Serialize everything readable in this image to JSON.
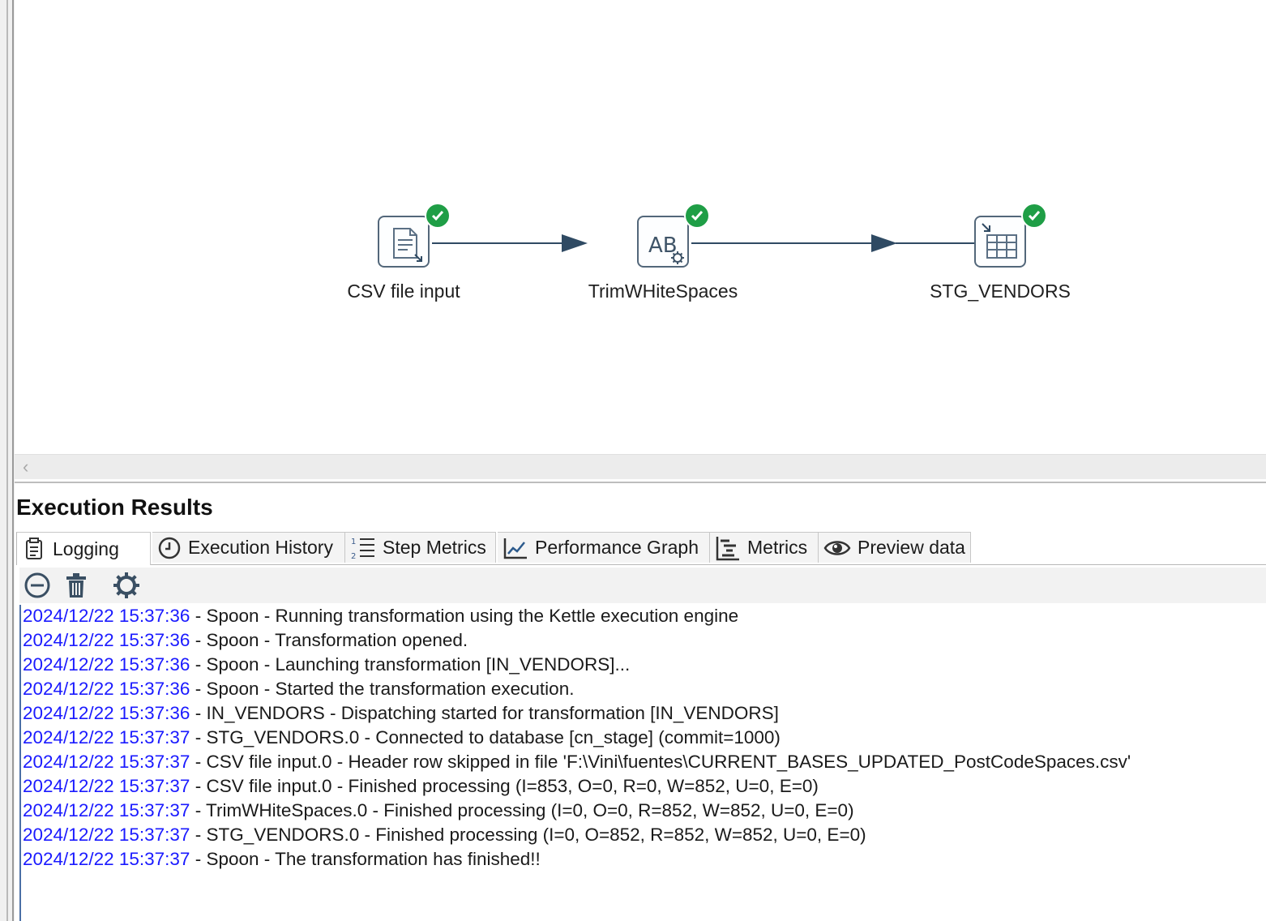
{
  "canvas": {
    "steps": [
      {
        "label": "CSV file input",
        "icon": "csv-file-input-icon",
        "status": "success"
      },
      {
        "label": "TrimWHiteSpaces",
        "icon": "string-operations-icon",
        "status": "success"
      },
      {
        "label": "STG_VENDORS",
        "icon": "table-output-icon",
        "status": "success"
      }
    ]
  },
  "results": {
    "title": "Execution Results",
    "tabs": [
      {
        "label": "Logging",
        "icon": "clipboard-icon"
      },
      {
        "label": "Execution History",
        "icon": "clock-icon"
      },
      {
        "label": "Step Metrics",
        "icon": "numbered-list-icon"
      },
      {
        "label": "Performance Graph",
        "icon": "line-chart-icon"
      },
      {
        "label": "Metrics",
        "icon": "gantt-icon"
      },
      {
        "label": "Preview data",
        "icon": "eye-icon"
      }
    ],
    "toolbar": [
      "clear-log-icon",
      "trash-icon",
      "settings-icon"
    ],
    "log": [
      {
        "ts": "2024/12/22 15:37:36",
        "msg": " - Spoon - Running transformation using the Kettle execution engine"
      },
      {
        "ts": "2024/12/22 15:37:36",
        "msg": " - Spoon - Transformation opened."
      },
      {
        "ts": "2024/12/22 15:37:36",
        "msg": " - Spoon - Launching transformation [IN_VENDORS]..."
      },
      {
        "ts": "2024/12/22 15:37:36",
        "msg": " - Spoon - Started the transformation execution."
      },
      {
        "ts": "2024/12/22 15:37:36",
        "msg": " - IN_VENDORS - Dispatching started for transformation [IN_VENDORS]"
      },
      {
        "ts": "2024/12/22 15:37:37",
        "msg": " - STG_VENDORS.0 - Connected to database [cn_stage] (commit=1000)"
      },
      {
        "ts": "2024/12/22 15:37:37",
        "msg": " - CSV file input.0 - Header row skipped in file 'F:\\Vini\\fuentes\\CURRENT_BASES_UPDATED_PostCodeSpaces.csv'"
      },
      {
        "ts": "2024/12/22 15:37:37",
        "msg": " - CSV file input.0 - Finished processing (I=853, O=0, R=0, W=852, U=0, E=0)"
      },
      {
        "ts": "2024/12/22 15:37:37",
        "msg": " - TrimWHiteSpaces.0 - Finished processing (I=0, O=0, R=852, W=852, U=0, E=0)"
      },
      {
        "ts": "2024/12/22 15:37:37",
        "msg": " - STG_VENDORS.0 - Finished processing (I=0, O=852, R=852, W=852, U=0, E=0)"
      },
      {
        "ts": "2024/12/22 15:37:37",
        "msg": " - Spoon - The transformation has finished!!"
      }
    ]
  }
}
